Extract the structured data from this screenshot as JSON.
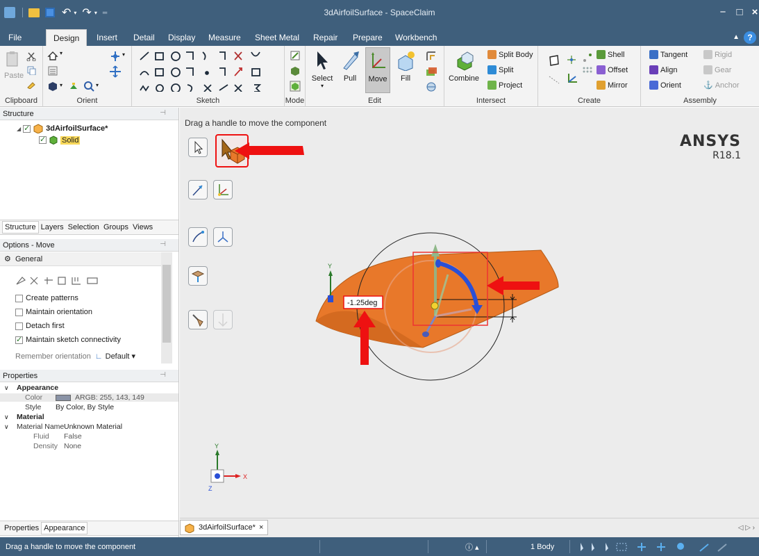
{
  "window": {
    "title": "3dAirfoilSurface - SpaceClaim"
  },
  "menu": {
    "tabs": [
      "File",
      "Design",
      "Insert",
      "Detail",
      "Display",
      "Measure",
      "Sheet Metal",
      "Repair",
      "Prepare",
      "Workbench"
    ],
    "active": "Design"
  },
  "ribbon": {
    "groups": {
      "clipboard": "Clipboard",
      "orient": "Orient",
      "sketch": "Sketch",
      "mode": "Mode",
      "edit": "Edit",
      "intersect": "Intersect",
      "create": "Create",
      "assembly": "Assembly"
    },
    "buttons": {
      "paste": "Paste",
      "select": "Select",
      "pull": "Pull",
      "move": "Move",
      "fill": "Fill",
      "combine": "Combine",
      "split_body": "Split Body",
      "split": "Split",
      "project": "Project",
      "shell": "Shell",
      "offset": "Offset",
      "mirror": "Mirror",
      "tangent": "Tangent",
      "rigid": "Rigid",
      "align": "Align",
      "gear": "Gear",
      "orient": "Orient",
      "anchor": "Anchor"
    }
  },
  "structure": {
    "title": "Structure",
    "root": "3dAirfoilSurface*",
    "child": "Solid",
    "tabs": [
      "Structure",
      "Layers",
      "Selection",
      "Groups",
      "Views"
    ]
  },
  "options": {
    "title": "Options - Move",
    "section": "General",
    "checkboxes": [
      {
        "label": "Create patterns",
        "checked": false
      },
      {
        "label": "Maintain orientation",
        "checked": false
      },
      {
        "label": "Detach first",
        "checked": false
      },
      {
        "label": "Maintain sketch connectivity",
        "checked": true
      }
    ],
    "remember_label": "Remember orientation",
    "remember_value": "Default"
  },
  "properties": {
    "title": "Properties",
    "appearance_header": "Appearance",
    "color_label": "Color",
    "color_value": "ARGB: 255, 143, 149",
    "style_label": "Style",
    "style_value": "By Color, By Style",
    "material_header": "Material",
    "material_name_label": "Material Name",
    "material_name_value": "Unknown Material",
    "fluid_label": "Fluid",
    "fluid_value": "False",
    "density_label": "Density",
    "density_value": "None",
    "tabs": [
      "Properties",
      "Appearance"
    ]
  },
  "viewport": {
    "hint": "Drag a handle to move the component",
    "angle_readout": "-1.25deg",
    "brand": "ANSYS",
    "version": "R18.1",
    "axis_y": "Y",
    "axis_x": "X",
    "axis_z": "Z"
  },
  "document_tab": "3dAirfoilSurface*",
  "status": {
    "message": "Drag a handle to move the component",
    "bodies": "1 Body"
  },
  "colors": {
    "titlebar": "#3f5f7c",
    "body_fill": "#e8782a",
    "annotation_arrow": "#ee1111",
    "rotate_handle": "#2a4fd6"
  }
}
